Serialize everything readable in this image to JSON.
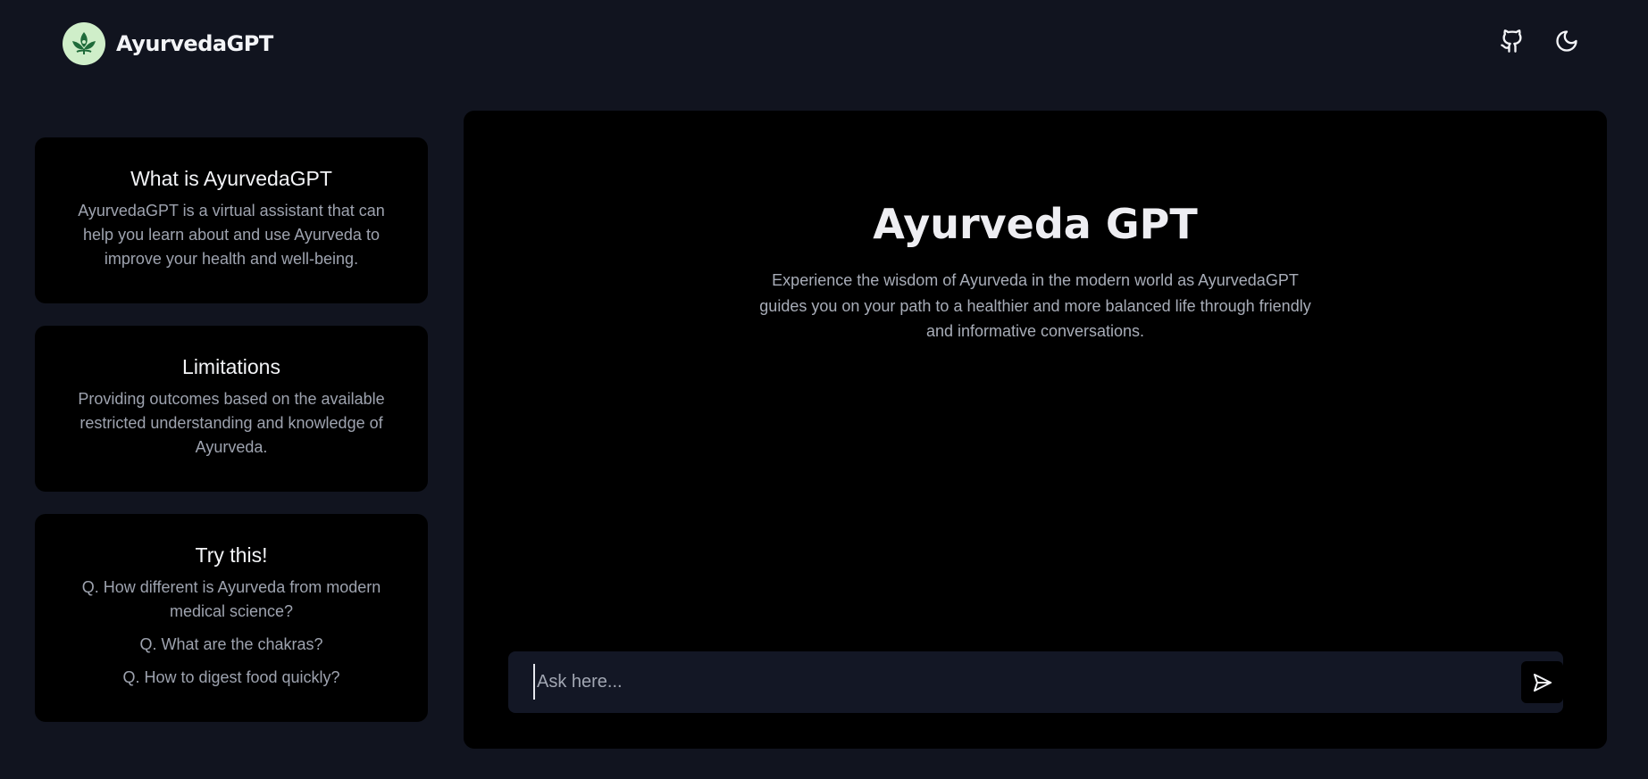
{
  "header": {
    "app_name": "AyurvedaGPT",
    "logo_icon": "leaf-logo-icon",
    "github_icon": "github-icon",
    "theme_icon": "moon-icon"
  },
  "sidebar": {
    "cards": [
      {
        "title": "What is AyurvedaGPT",
        "text": "AyurvedaGPT is a virtual assistant that can help you learn about and use Ayurveda to improve your health and well-being."
      },
      {
        "title": "Limitations",
        "text": "Providing outcomes based on the available restricted understanding and knowledge of Ayurveda."
      },
      {
        "title": "Try this!",
        "questions": [
          "Q. How different is Ayurveda from modern medical science?",
          "Q. What are the chakras?",
          "Q. How to digest food quickly?"
        ]
      }
    ]
  },
  "main": {
    "title": "Ayurveda GPT",
    "description": "Experience the wisdom of Ayurveda in the modern world as AyurvedaGPT guides you on your path to a healthier and more balanced life through friendly and informative conversations.",
    "input": {
      "placeholder": "Ask here...",
      "value": ""
    },
    "send_icon": "send-icon"
  },
  "colors": {
    "background": "#11141f",
    "panel": "#000000",
    "input_bg": "#131725",
    "logo_bg": "#cfeec9",
    "logo_green": "#1f6b3a",
    "muted_text": "#9ea3af"
  }
}
